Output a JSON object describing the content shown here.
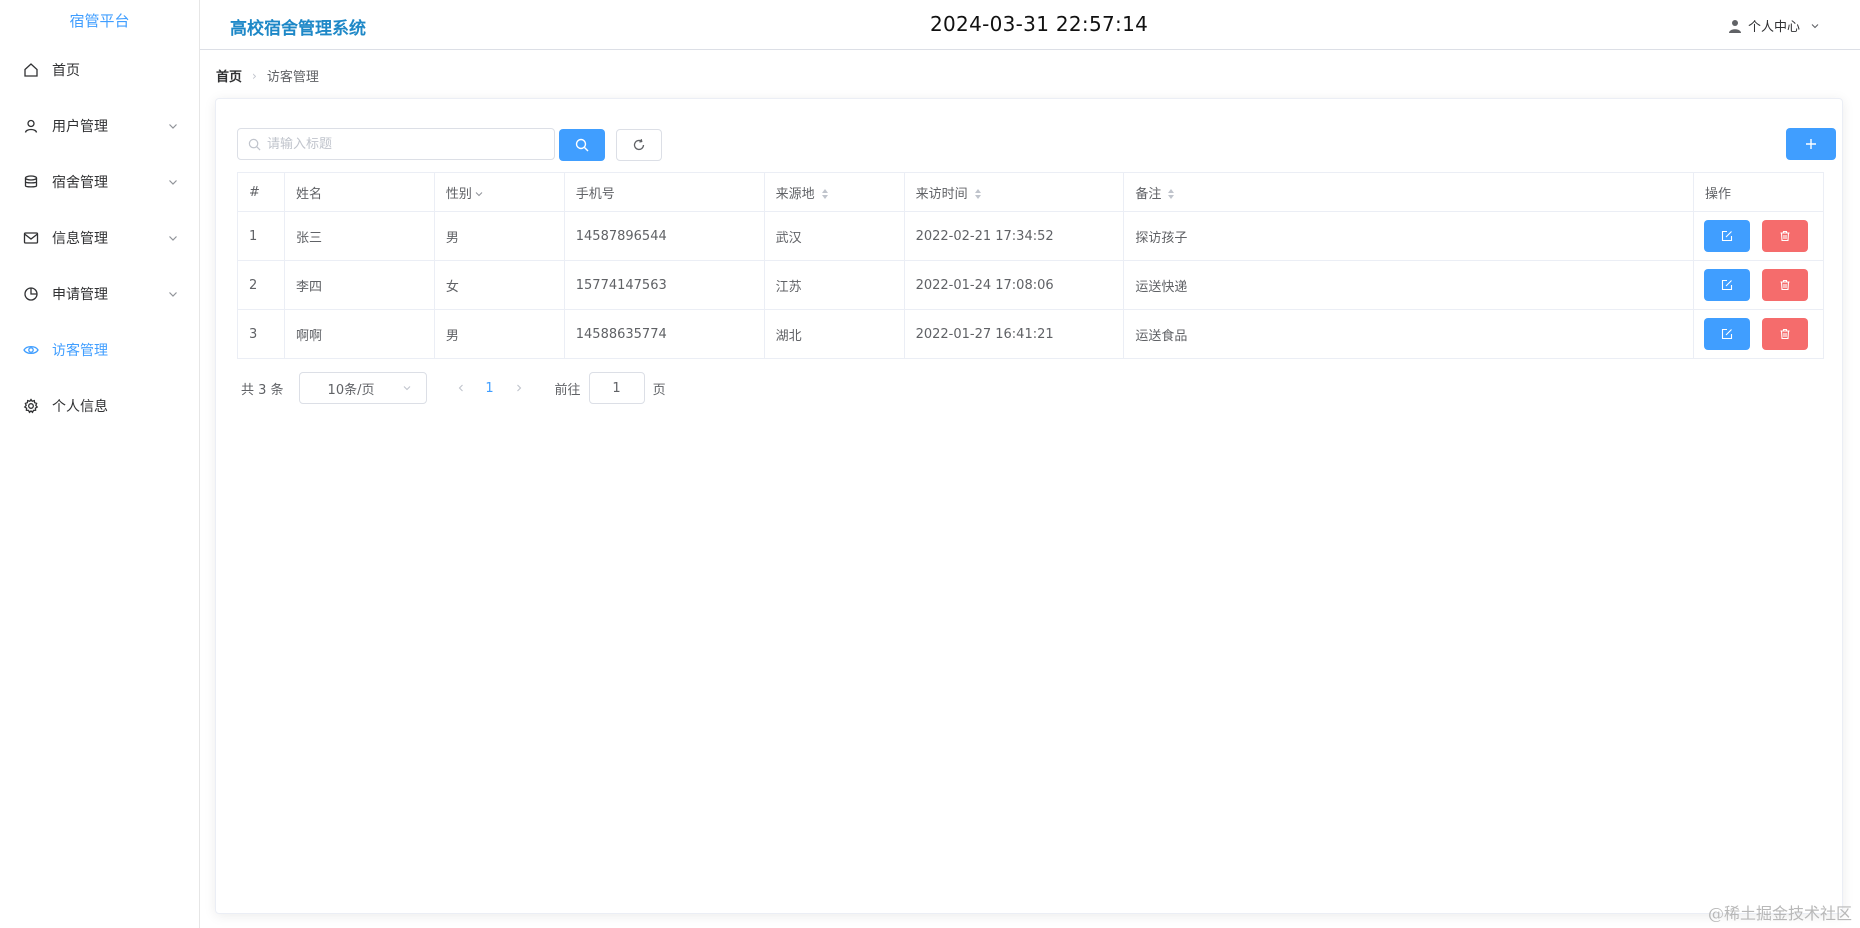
{
  "sidebar": {
    "brand": "宿管平台",
    "items": [
      {
        "label": "首页",
        "icon": "home-icon",
        "expandable": false,
        "active": false
      },
      {
        "label": "用户管理",
        "icon": "user-icon",
        "expandable": true,
        "active": false
      },
      {
        "label": "宿舍管理",
        "icon": "database-icon",
        "expandable": true,
        "active": false
      },
      {
        "label": "信息管理",
        "icon": "mail-icon",
        "expandable": true,
        "active": false
      },
      {
        "label": "申请管理",
        "icon": "pie-chart-icon",
        "expandable": true,
        "active": false
      },
      {
        "label": "访客管理",
        "icon": "eye-icon",
        "expandable": false,
        "active": true
      },
      {
        "label": "个人信息",
        "icon": "gear-icon",
        "expandable": false,
        "active": false
      }
    ]
  },
  "header": {
    "title": "高校宿舍管理系统",
    "clock": "2024-03-31 22:57:14",
    "user_menu": "个人中心"
  },
  "breadcrumb": {
    "home": "首页",
    "current": "访客管理"
  },
  "toolbar": {
    "search_placeholder": "请输入标题",
    "search_value": ""
  },
  "table": {
    "headers": {
      "index": "#",
      "name": "姓名",
      "gender": "性别",
      "phone": "手机号",
      "origin": "来源地",
      "visit_time": "来访时间",
      "remark": "备注",
      "actions": "操作"
    },
    "rows": [
      {
        "index": "1",
        "name": "张三",
        "gender": "男",
        "phone": "14587896544",
        "origin": "武汉",
        "visit_time": "2022-02-21 17:34:52",
        "remark": "探访孩子"
      },
      {
        "index": "2",
        "name": "李四",
        "gender": "女",
        "phone": "15774147563",
        "origin": "江苏",
        "visit_time": "2022-01-24 17:08:06",
        "remark": "运送快递"
      },
      {
        "index": "3",
        "name": "啊啊",
        "gender": "男",
        "phone": "14588635774",
        "origin": "湖北",
        "visit_time": "2022-01-27 16:41:21",
        "remark": "运送食品"
      }
    ]
  },
  "pagination": {
    "total": "共 3 条",
    "page_size": "10条/页",
    "current_page": "1",
    "jump_label": "前往",
    "jump_value": "1",
    "jump_suffix": "页"
  },
  "watermark": "@稀土掘金技术社区",
  "colors": {
    "primary": "#409eff",
    "danger": "#f56c6c",
    "title": "#1e88c7"
  }
}
